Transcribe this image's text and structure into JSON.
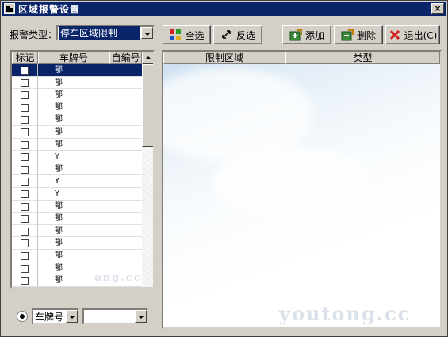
{
  "window": {
    "title": "区域报警设置",
    "close_label": "×"
  },
  "filter": {
    "alarm_type_label": "报警类型：",
    "alarm_type_value": "停车区域限制"
  },
  "toolbar": {
    "select_all_label": "全选",
    "invert_label": "反选",
    "add_label": "添加",
    "delete_label": "删除",
    "exit_label": "退出(C)"
  },
  "vehicle_table": {
    "columns": [
      "标记",
      "车牌号",
      "自编号"
    ],
    "rows": [
      {
        "checked": false,
        "plate": "鄂",
        "no": "",
        "selected": true
      },
      {
        "checked": false,
        "plate": "鄂",
        "no": ""
      },
      {
        "checked": false,
        "plate": "鄂",
        "no": ""
      },
      {
        "checked": false,
        "plate": "鄂",
        "no": ""
      },
      {
        "checked": false,
        "plate": "鄂",
        "no": ""
      },
      {
        "checked": false,
        "plate": "鄂",
        "no": ""
      },
      {
        "checked": false,
        "plate": "鄂",
        "no": ""
      },
      {
        "checked": false,
        "plate": "Y",
        "no": ""
      },
      {
        "checked": false,
        "plate": "鄂",
        "no": ""
      },
      {
        "checked": false,
        "plate": "Y",
        "no": ""
      },
      {
        "checked": false,
        "plate": "Y",
        "no": ""
      },
      {
        "checked": false,
        "plate": "鄂",
        "no": ""
      },
      {
        "checked": false,
        "plate": "鄂",
        "no": ""
      },
      {
        "checked": false,
        "plate": "鄂",
        "no": ""
      },
      {
        "checked": false,
        "plate": "鄂",
        "no": ""
      },
      {
        "checked": false,
        "plate": "鄂",
        "no": ""
      },
      {
        "checked": false,
        "plate": "鄂",
        "no": ""
      },
      {
        "checked": false,
        "plate": "鄂",
        "no": ""
      },
      {
        "checked": false,
        "plate": "鄂",
        "no": ""
      }
    ]
  },
  "region_table": {
    "columns": [
      "限制区域",
      "类型"
    ]
  },
  "search": {
    "field_value": "车牌号",
    "query_value": ""
  },
  "watermarks": {
    "small": "ong.cc",
    "large": "youtong.cc"
  }
}
